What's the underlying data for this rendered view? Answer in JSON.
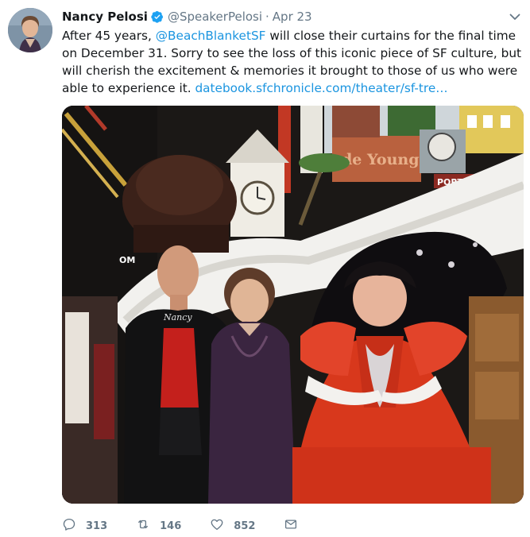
{
  "tweet": {
    "author_name": "Nancy Pelosi",
    "handle": "@SpeakerPelosi",
    "separator": "·",
    "date": "Apr 23",
    "text_intro": "After 45 years, ",
    "mention": "@BeachBlanketSF",
    "text_body": " will close their curtains for the final time on December 31. Sorry to see the loss of this iconic piece of SF culture, but will cherish the excitement & memories it brought to those of us who were able to experience it. ",
    "link": "datebook.sfchronicle.com/theater/sf-tre…"
  },
  "media": {
    "sign_deyoung": "de Young",
    "sign_port": "PORT OF SAN FRANCIS",
    "necklace_text": "Nancy",
    "hat_sign": "OM"
  },
  "actions": {
    "reply_count": "313",
    "retweet_count": "146",
    "like_count": "852"
  },
  "icons": {
    "verified": "verified-badge-icon",
    "caret": "chevron-down-icon",
    "reply": "reply-icon",
    "retweet": "retweet-icon",
    "like": "heart-icon",
    "dm": "envelope-icon"
  },
  "colors": {
    "link": "#1b95e0",
    "muted": "#657786",
    "verified": "#1da1f2"
  }
}
